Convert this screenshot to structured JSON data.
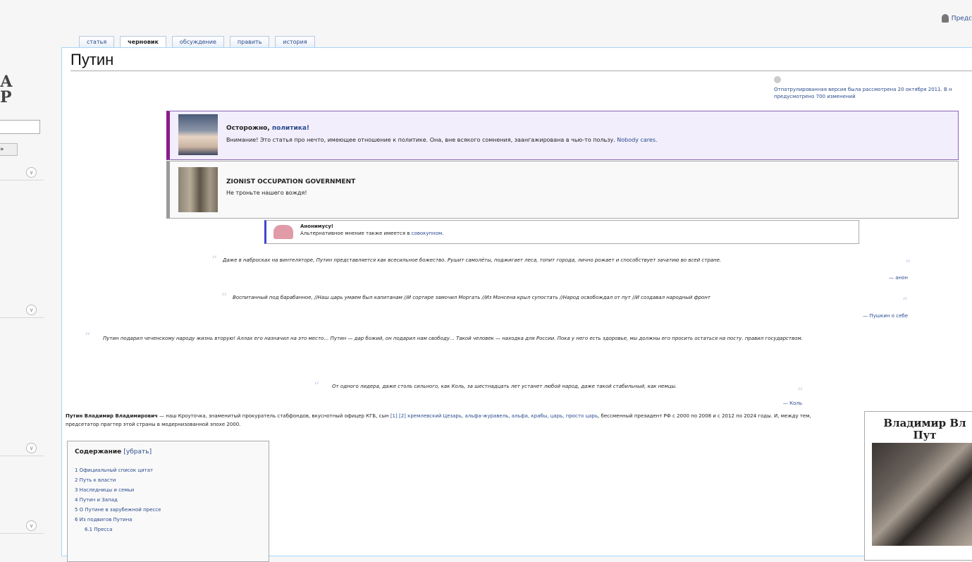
{
  "user": {
    "label": "Предс"
  },
  "sidebar": {
    "logo_fragment": "А\nР",
    "search_button": "»",
    "portal_chevron": "∨"
  },
  "tabs": [
    {
      "label": "статья"
    },
    {
      "label": "черновик"
    },
    {
      "label": "обсуждение"
    },
    {
      "label": "править"
    },
    {
      "label": "история"
    }
  ],
  "page": {
    "title": "Путин"
  },
  "flagged": {
    "text": "Отпатрулированная версия была рассмотрена 20 октября 2011. В н предусмотрено 700 изменений"
  },
  "boxes": {
    "warning": {
      "title_prefix": "Осторожно, ",
      "title_link": "политика!",
      "text": "Внимание! Это статья про нечто, имеющее отношение к политике. Она, вне всякого сомнения, заангажирована в чью-то пользу. ",
      "text_link": "Nobody cares."
    },
    "zog": {
      "title": "ZIONIST OCCUPATION GOVERNMENT",
      "text": "Не троньте нашего вождя!"
    },
    "anonymous": {
      "title": "Анонимусу!",
      "text": "Альтернативное мнение также имеется в ",
      "link": "совокупном."
    }
  },
  "quotes": [
    {
      "text": "Даже в набросках на винтеляторе, Путин представляется как всесильное божество. Рушит самолёты, поджигает леса, топит города, лично рожает и способствует зачатию во всей стране.",
      "attribution": "— анон"
    },
    {
      "text": "Воспитанный под барабанное, //Наш царь умаем был капитанам //И сортире замочил Моргать //Из Монсена крыл супостать //Народ освобождал от пут //И создавал народный фронт",
      "attribution": "— Пушкин о себе"
    },
    {
      "text": "Путин подарил чеченскому народу жизнь вторую! Аллах его назначил на это место… Путин — дар божий, он подарил нам свободу… Такой человек — находка для России. Пока у него есть здоровье, мы должны его просить остаться на посту. правил государством.",
      "attribution": ""
    },
    {
      "text": "От одного лидера, даже столь сильного, как Коль, за шестнадцать лет устанет любой народ, даже такой стабильный, как немцы.",
      "attribution": "— Коль"
    }
  ],
  "intro": {
    "bold": "Путин Владимир Владимирович",
    "text": " — наш Кроуточка, знаменитый прокуратель стабфондов, вкуснотный офицер КГБ, сын ",
    "links": "[1] [2] кремлевский Цезарь, альфа-журавель, альфа, крабы, царь, просто царь",
    "tail": ", бессменный президент РФ с 2000 по 2008 и с 2012 по 2024 годы. И, между тем, предсетатор прагтер этой страны в модернизованной эпохе 2000."
  },
  "toc": {
    "title": "Содержание",
    "toggle": "[убрать]",
    "items": [
      {
        "label": "1 Официальный список цитат"
      },
      {
        "label": "2 Путь к власти"
      },
      {
        "label": "3 Наследницы и семьи"
      },
      {
        "label": "4 Путин и Запад"
      },
      {
        "label": "5 О Путине в зарубежной прессе"
      },
      {
        "label": "6 Из подвигов Путина"
      },
      {
        "label": "6.1 Пресса",
        "sub": true
      }
    ]
  },
  "infobox": {
    "title": "Владимир Вл Пут"
  }
}
